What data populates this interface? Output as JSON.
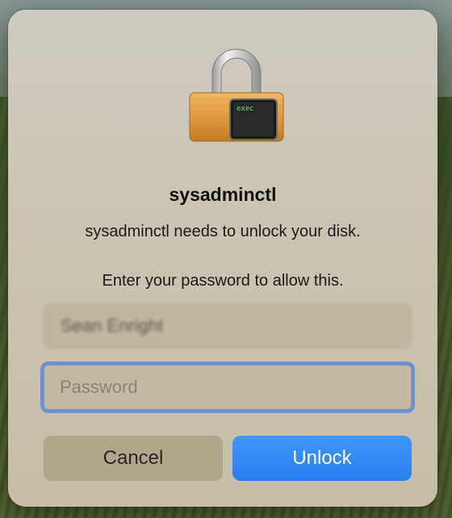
{
  "dialog": {
    "icon": "lock-with-terminal-icon",
    "terminal_badge_text": "exec",
    "app_name": "sysadminctl",
    "message": "sysadminctl needs to unlock your disk.",
    "instruction": "Enter your password to allow this.",
    "username_value": "Sean Enright",
    "password_placeholder": "Password",
    "cancel_label": "Cancel",
    "unlock_label": "Unlock"
  },
  "colors": {
    "accent": "#2a7ef2",
    "focus_ring": "#6f8fd0"
  }
}
